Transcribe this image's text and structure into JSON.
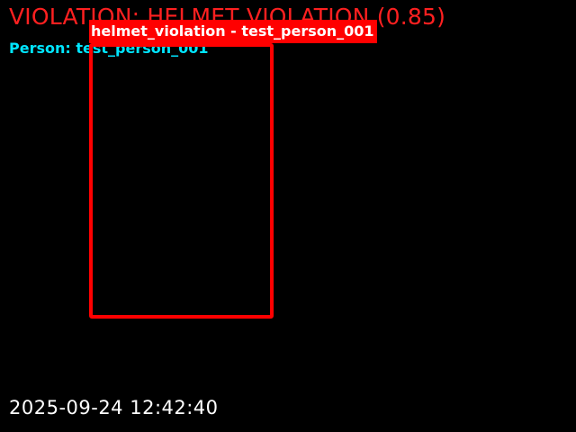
{
  "overlay": {
    "violation_text": "VIOLATION: HELMET VIOLATION (0.85)",
    "person_text": "Person: test_person_001",
    "timestamp": "2025-09-24 12:42:40"
  },
  "detection": {
    "label": "helmet_violation - test_person_001"
  },
  "colors": {
    "background": "#000000",
    "violation_text": "#ff2020",
    "person_text": "#00e5ff",
    "box": "#ff0000",
    "label_bg": "#ff0000",
    "label_text": "#ffffff",
    "timestamp": "#ffffff"
  }
}
